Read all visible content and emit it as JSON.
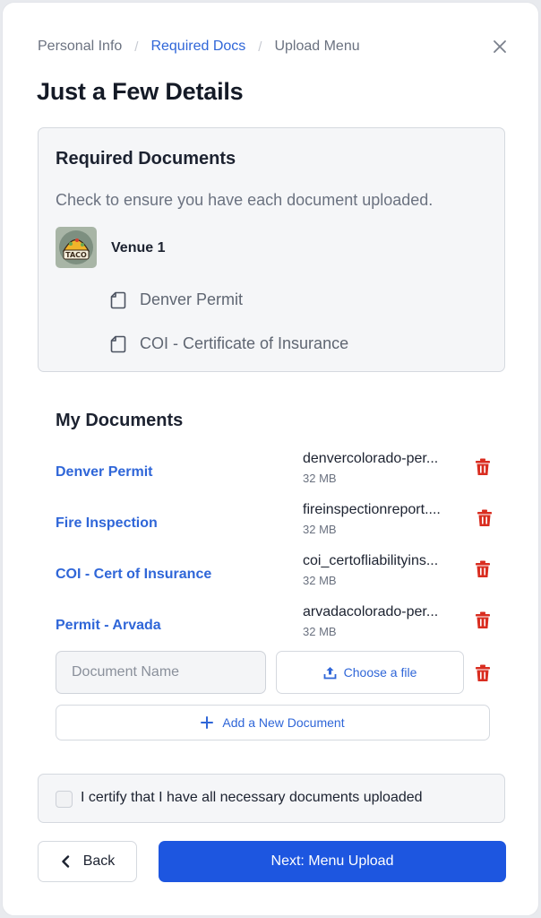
{
  "breadcrumb": [
    {
      "label": "Personal Info",
      "active": false
    },
    {
      "label": "Required Docs",
      "active": true
    },
    {
      "label": "Upload Menu",
      "active": false
    }
  ],
  "page_title": "Just a Few Details",
  "required": {
    "title": "Required Documents",
    "description": "Check to ensure you have each document uploaded.",
    "venue": {
      "name": "Venue 1",
      "logo_text": "TACO"
    },
    "documents": [
      "Denver Permit",
      "COI - Certificate of Insurance"
    ]
  },
  "my_documents": {
    "title": "My Documents",
    "rows": [
      {
        "name": "Denver Permit",
        "file": "denvercolorado-per...",
        "size": "32 MB"
      },
      {
        "name": "Fire Inspection",
        "file": "fireinspectionreport....",
        "size": "32 MB"
      },
      {
        "name": "COI - Cert of Insurance",
        "file": "coi_certofliabilityins...",
        "size": "32 MB"
      },
      {
        "name": "Permit - Arvada",
        "file": "arvadacolorado-per...",
        "size": "32 MB"
      }
    ],
    "new_doc": {
      "placeholder": "Document Name",
      "value": "",
      "choose_label": "Choose a file"
    },
    "add_label": "Add a New Document"
  },
  "certify": {
    "label": "I certify that I have all necessary documents uploaded",
    "checked": false
  },
  "footer": {
    "back_label": "Back",
    "next_label": "Next: Menu Upload"
  },
  "colors": {
    "accent": "#2f66d8",
    "primary_button": "#1d56e0",
    "danger": "#d92d20"
  },
  "icons": {
    "close": "close-icon",
    "document": "document-icon",
    "trash": "trash-icon",
    "upload": "upload-icon",
    "plus": "plus-icon",
    "back": "chevron-left-icon"
  }
}
